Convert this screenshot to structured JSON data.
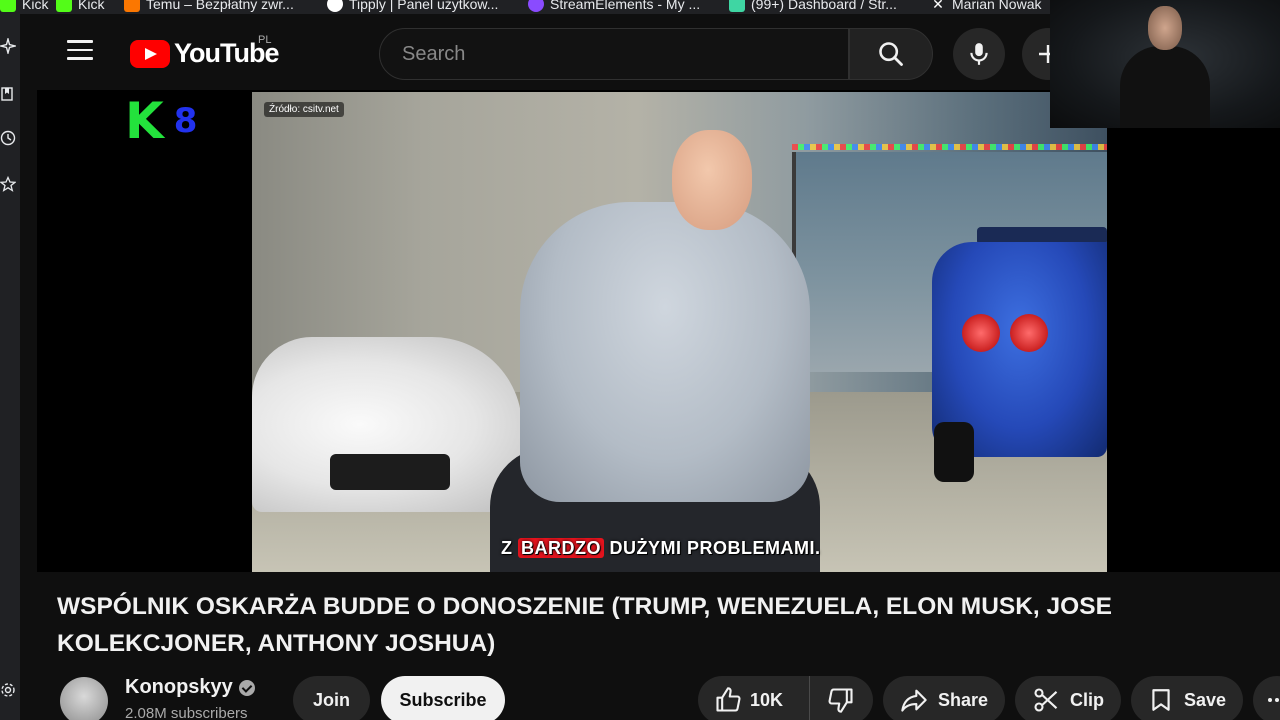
{
  "bookmarks": [
    {
      "label": "Kick",
      "color": "#53fc18"
    },
    {
      "label": "Kick",
      "color": "#53fc18"
    },
    {
      "label": "Temu – Bezpłatny zwr...",
      "color": "#fb7701"
    },
    {
      "label": "Tipply | Panel użytkow...",
      "color": "#ffffff"
    },
    {
      "label": "StreamElements - My ...",
      "color": "#8a4bff"
    },
    {
      "label": "(99+) Dashboard / Str...",
      "color": "#3fd6a3"
    },
    {
      "label": "Marian Nowak",
      "color": "#ffffff"
    }
  ],
  "masthead": {
    "logo_text": "YouTube",
    "country_code": "PL",
    "search_placeholder": "Search"
  },
  "video": {
    "source_watermark": "Źródło: csitv.net",
    "overlay_logo_letter": "K",
    "overlay_logo_number": "8",
    "subtitle_before": "Z",
    "subtitle_highlight": "BARDZO",
    "subtitle_after": "DUŻYMI PROBLEMAMI."
  },
  "title": "WSPÓLNIK OSKARŻA BUDDE O DONOSZENIE (TRUMP, WENEZUELA, ELON MUSK, JOSE KOLEKCJONER, ANTHONY JOSHUA)",
  "channel": {
    "name": "Konopskyy",
    "subscribers": "2.08M subscribers"
  },
  "actions": {
    "join": "Join",
    "subscribe": "Subscribe",
    "likes": "10K",
    "share": "Share",
    "clip": "Clip",
    "save": "Save"
  },
  "colors": {
    "background": "#0f0f0f",
    "brand_red": "#ff0000",
    "subtitle_highlight": "#e3131d",
    "button_bg": "#272727"
  },
  "icons": [
    "menu-icon",
    "search-icon",
    "mic-icon",
    "create-icon",
    "verified-icon",
    "like-icon",
    "dislike-icon",
    "share-icon",
    "clip-icon",
    "save-icon",
    "more-icon"
  ]
}
